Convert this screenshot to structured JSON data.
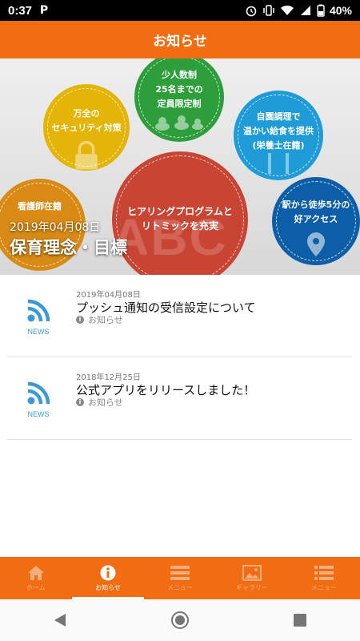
{
  "status_bar": {
    "time": "0:37",
    "app_badge": "P",
    "battery": "40%"
  },
  "header": {
    "title": "お知らせ"
  },
  "hero": {
    "circles": {
      "green": [
        "少人数制",
        "25名までの",
        "定員限定制"
      ],
      "yellow": [
        "万全の",
        "セキュリティ対策"
      ],
      "blue": [
        "自園調理で",
        "温かい給食を提供",
        "(栄養士在籍)"
      ],
      "red": [
        "ヒアリングプログラムと",
        "リトミックを充実"
      ],
      "darkblue": [
        "駅から徒歩5分の",
        "好アクセス"
      ],
      "orange": [
        "看護師在籍"
      ]
    },
    "abc_text": "ABC",
    "date": "2019年04月08日",
    "title": "保育理念・目標"
  },
  "news": [
    {
      "icon_label": "NEWS",
      "date": "2019年04月08日",
      "title": "プッシュ通知の受信設定について",
      "category": "お知らせ"
    },
    {
      "icon_label": "NEWS",
      "date": "2018年12月25日",
      "title": "公式アプリをリリースしました！",
      "category": "お知らせ"
    }
  ],
  "tabs": [
    {
      "label": "ホーム",
      "icon": "home-icon",
      "active": false
    },
    {
      "label": "お知らせ",
      "icon": "info-icon",
      "active": true
    },
    {
      "label": "メニュー",
      "icon": "menu-list-icon",
      "active": false
    },
    {
      "label": "ギャラリー",
      "icon": "gallery-icon",
      "active": false
    },
    {
      "label": "メニュー",
      "icon": "list-icon",
      "active": false
    }
  ],
  "colors": {
    "brand": "#f26c12",
    "news_icon": "#3a9ad9"
  }
}
